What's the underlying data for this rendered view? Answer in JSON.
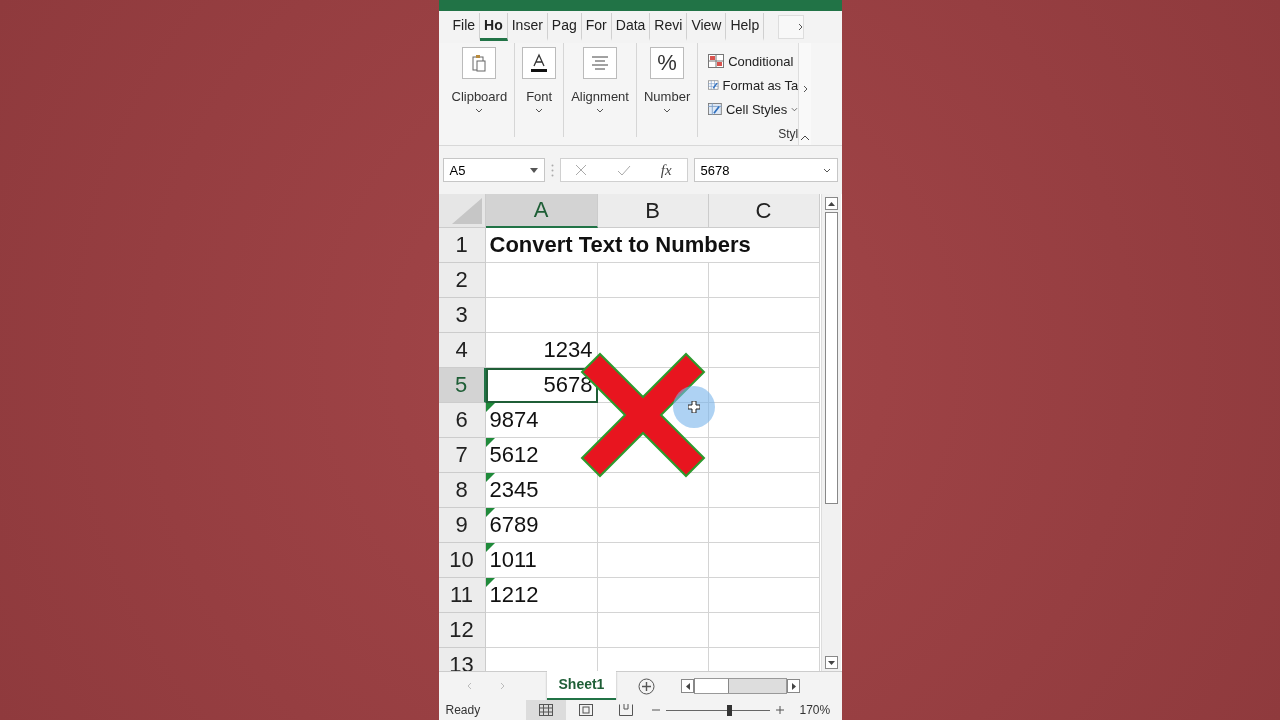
{
  "tabs": [
    {
      "label": "File",
      "selected": false
    },
    {
      "label": "Ho",
      "selected": true
    },
    {
      "label": "Inser",
      "selected": false
    },
    {
      "label": "Pag",
      "selected": false
    },
    {
      "label": "For",
      "selected": false
    },
    {
      "label": "Data",
      "selected": false
    },
    {
      "label": "Revi",
      "selected": false
    },
    {
      "label": "View",
      "selected": false
    },
    {
      "label": "Help",
      "selected": false
    }
  ],
  "ribbon_groups": [
    {
      "label": "Clipboard",
      "kind": "clipboard"
    },
    {
      "label": "Font",
      "kind": "font"
    },
    {
      "label": "Alignment",
      "kind": "alignment"
    },
    {
      "label": "Number",
      "kind": "number",
      "symbol": "%"
    }
  ],
  "styles_group": {
    "label": "Styl",
    "items": [
      {
        "label": "Conditional",
        "kind": "conditional"
      },
      {
        "label": "Format as Ta",
        "kind": "table"
      },
      {
        "label": "Cell Styles",
        "kind": "cellstyles"
      }
    ]
  },
  "formula_bar": {
    "name_box": "A5",
    "fx": "fx",
    "formula": "5678"
  },
  "columns": [
    {
      "label": "A",
      "selected": true
    },
    {
      "label": "B",
      "selected": false
    },
    {
      "label": "C",
      "selected": false
    }
  ],
  "rows": [
    {
      "label": "1",
      "selected": false,
      "a": {
        "text": "Convert Text to Numbers",
        "kind": "title"
      }
    },
    {
      "label": "2",
      "selected": false
    },
    {
      "label": "3",
      "selected": false
    },
    {
      "label": "4",
      "selected": false,
      "a": {
        "text": "1234",
        "kind": "number"
      }
    },
    {
      "label": "5",
      "selected": true,
      "a": {
        "text": "5678",
        "kind": "number"
      }
    },
    {
      "label": "6",
      "selected": false,
      "a": {
        "text": "9874",
        "kind": "text"
      }
    },
    {
      "label": "7",
      "selected": false,
      "a": {
        "text": "5612",
        "kind": "text"
      }
    },
    {
      "label": "8",
      "selected": false,
      "a": {
        "text": "2345",
        "kind": "text"
      }
    },
    {
      "label": "9",
      "selected": false,
      "a": {
        "text": "6789",
        "kind": "text"
      }
    },
    {
      "label": "10",
      "selected": false,
      "a": {
        "text": "1011",
        "kind": "text"
      }
    },
    {
      "label": "11",
      "selected": false,
      "a": {
        "text": "1212",
        "kind": "text"
      }
    },
    {
      "label": "12",
      "selected": false
    },
    {
      "label": "13",
      "selected": false
    }
  ],
  "sheet_tabs": [
    {
      "label": "Sheet1",
      "selected": true
    }
  ],
  "status_bar": {
    "text": "Ready",
    "views": [
      {
        "kind": "normal",
        "selected": true
      },
      {
        "kind": "layout",
        "selected": false
      },
      {
        "kind": "pagebreak",
        "selected": false
      }
    ],
    "zoom_slider": {
      "level": 0.61
    },
    "zoom": "170%"
  }
}
